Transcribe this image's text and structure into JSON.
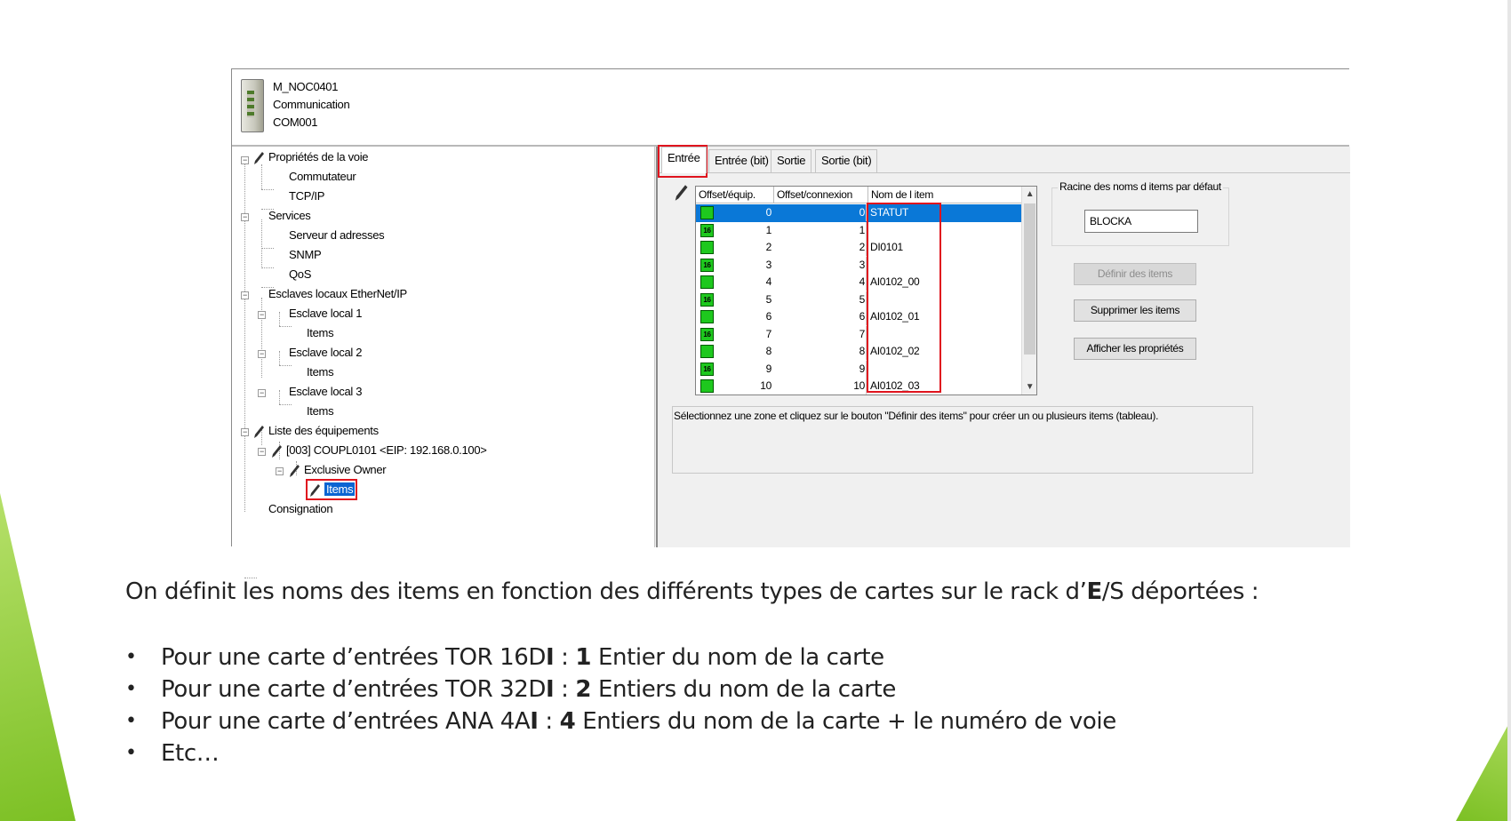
{
  "header": {
    "line1": "M_NOC0401",
    "line2": "Communication",
    "line3": "COM001"
  },
  "tree": {
    "items": [
      {
        "label": "Propriétés de la voie"
      },
      {
        "label": "Commutateur"
      },
      {
        "label": "TCP/IP"
      },
      {
        "label": "Services"
      },
      {
        "label": "Serveur d adresses"
      },
      {
        "label": "SNMP"
      },
      {
        "label": "QoS"
      },
      {
        "label": "Esclaves locaux EtherNet/IP"
      },
      {
        "label": "Esclave local 1"
      },
      {
        "label": "Items"
      },
      {
        "label": "Esclave local 2"
      },
      {
        "label": "Items"
      },
      {
        "label": "Esclave local 3"
      },
      {
        "label": "Items"
      },
      {
        "label": "Liste des équipements"
      },
      {
        "label": "[003] COUPL0101 <EIP: 192.168.0.100>"
      },
      {
        "label": "Exclusive Owner"
      },
      {
        "label": "Items"
      },
      {
        "label": "Consignation"
      }
    ]
  },
  "tabs": [
    "Entrée",
    "Entrée (bit)",
    "Sortie",
    "Sortie (bit)"
  ],
  "grid": {
    "columns": [
      "Offset/équip.",
      "Offset/connexion",
      "Nom de l item"
    ],
    "rows": [
      {
        "icon": "",
        "off": "0",
        "con": "0",
        "name": "STATUT"
      },
      {
        "icon": "16",
        "off": "1",
        "con": "1",
        "name": ""
      },
      {
        "icon": "",
        "off": "2",
        "con": "2",
        "name": "DI0101"
      },
      {
        "icon": "16",
        "off": "3",
        "con": "3",
        "name": ""
      },
      {
        "icon": "",
        "off": "4",
        "con": "4",
        "name": "AI0102_00"
      },
      {
        "icon": "16",
        "off": "5",
        "con": "5",
        "name": ""
      },
      {
        "icon": "",
        "off": "6",
        "con": "6",
        "name": "AI0102_01"
      },
      {
        "icon": "16",
        "off": "7",
        "con": "7",
        "name": ""
      },
      {
        "icon": "",
        "off": "8",
        "con": "8",
        "name": "AI0102_02"
      },
      {
        "icon": "16",
        "off": "9",
        "con": "9",
        "name": ""
      },
      {
        "icon": "",
        "off": "10",
        "con": "10",
        "name": "AI0102_03"
      }
    ]
  },
  "root_group": {
    "legend": "Racine des noms d items par défaut",
    "value": "BLOCKA"
  },
  "buttons": {
    "define": "Définir des items",
    "delete": "Supprimer les items",
    "props": "Afficher les propriétés"
  },
  "message": "Sélectionnez une zone et cliquez sur le bouton \"Définir des items\" pour créer un ou plusieurs items (tableau).",
  "caption": {
    "before": "On définit les noms des items en fonction des différents types de cartes sur le rack d’",
    "bold": "E",
    "after": "/S déportées :"
  },
  "bullets": [
    {
      "a": "Pour une carte d’entrées TOR 16D",
      "b1": "I",
      "c": " : ",
      "b2": "1",
      "d": " Entier du nom de la carte"
    },
    {
      "a": "Pour une carte d’entrées TOR 32D",
      "b1": "I",
      "c": " : ",
      "b2": "2",
      "d": " Entiers du nom de la carte"
    },
    {
      "a": "Pour une carte d’entrées ANA 4A",
      "b1": "I",
      "c": " :  ",
      "b2": "4",
      "d": " Entiers du nom de la carte + le numéro de voie"
    },
    {
      "a": "Etc…",
      "b1": "",
      "c": "",
      "b2": "",
      "d": ""
    }
  ],
  "colors": {
    "accent_green": "#7cc024",
    "highlight_red": "#e0141e",
    "selection_blue": "#0a78d7"
  }
}
